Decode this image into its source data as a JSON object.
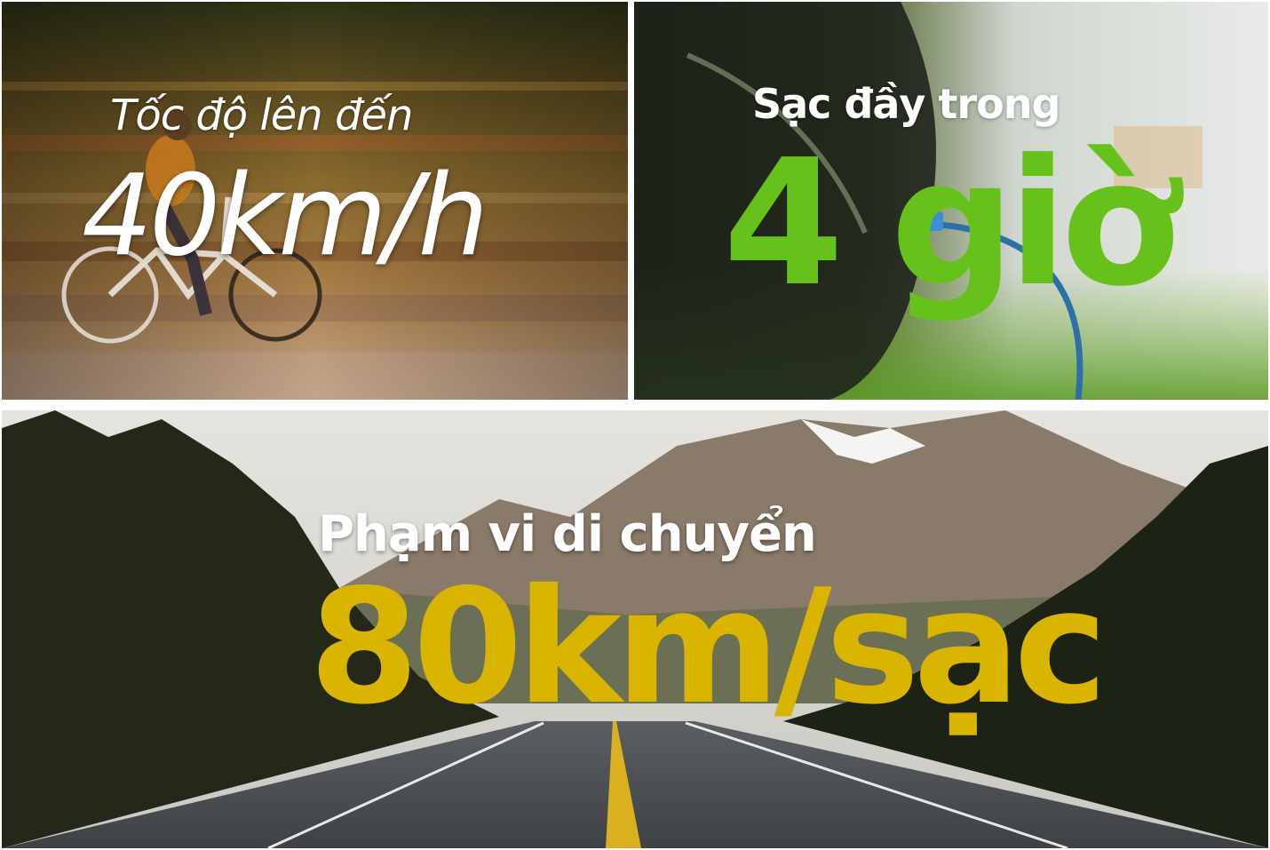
{
  "colors": {
    "caption_white": "#ffffff",
    "charge_green": "#66c21a",
    "range_yellow": "#d9b500",
    "frame": "#ffffff"
  },
  "panels": {
    "speed": {
      "label": "Tốc độ lên đến",
      "value": "40km/h"
    },
    "charge": {
      "label": "Sạc  đầy trong",
      "value": "4 giờ"
    },
    "range": {
      "label": "Phạm vi di chuyển",
      "value": "80km/sạc"
    }
  }
}
